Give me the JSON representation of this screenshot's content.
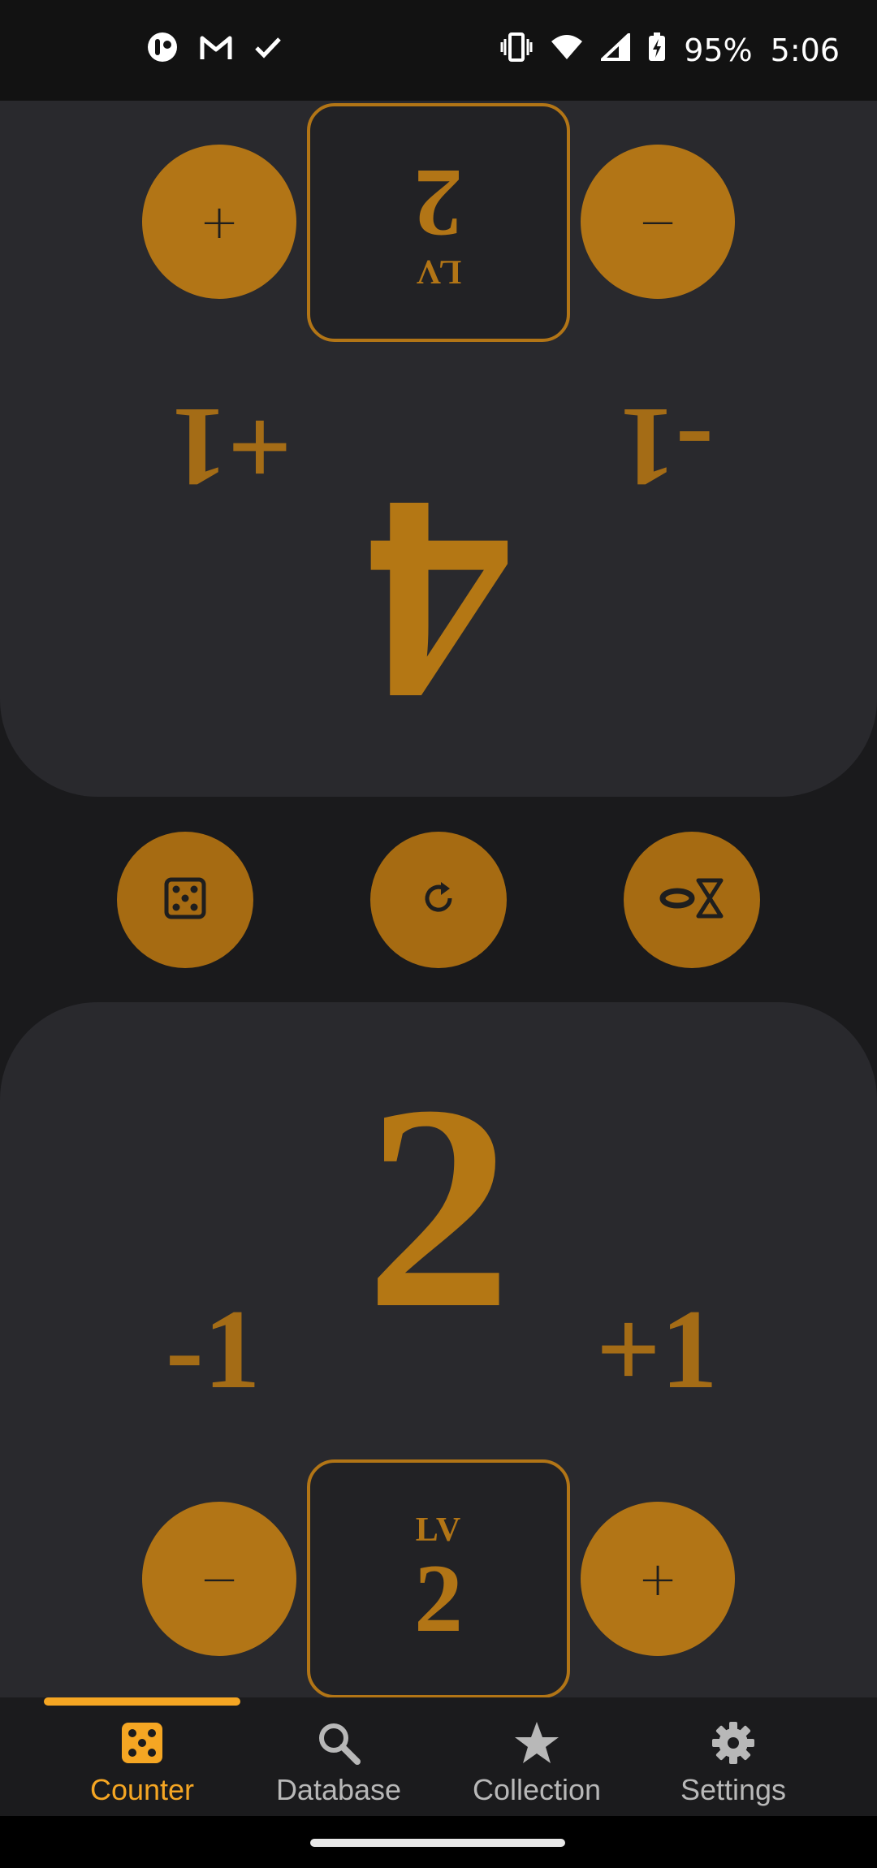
{
  "status_bar": {
    "battery": "95%",
    "time": "5:06",
    "left_icons": [
      "app-notification-icon",
      "gmail-icon",
      "check-icon"
    ],
    "right_icons": [
      "vibrate-icon",
      "wifi-icon",
      "signal-icon",
      "battery-charging-icon"
    ]
  },
  "opponent": {
    "life": "4",
    "level_label": "LV",
    "level_value": "2",
    "plus_label": "+",
    "minus_label": "−",
    "delta_plus": "+1",
    "delta_minus": "-1"
  },
  "tools": [
    "dice-icon",
    "reset-icon",
    "timer-icon"
  ],
  "player": {
    "life": "2",
    "level_label": "LV",
    "level_value": "2",
    "plus_label": "+",
    "minus_label": "−",
    "delta_plus": "+1",
    "delta_minus": "-1"
  },
  "nav": {
    "items": [
      {
        "label": "Counter",
        "icon": "dice-icon",
        "active": true
      },
      {
        "label": "Database",
        "icon": "search-icon",
        "active": false
      },
      {
        "label": "Collection",
        "icon": "star-icon",
        "active": false
      },
      {
        "label": "Settings",
        "icon": "gear-icon",
        "active": false
      }
    ]
  },
  "colors": {
    "accent": "#b27516",
    "accent_bright": "#f5a623",
    "panel": "#29292d",
    "background": "#1a1a1c",
    "inactive_text": "#b8b8b8"
  }
}
